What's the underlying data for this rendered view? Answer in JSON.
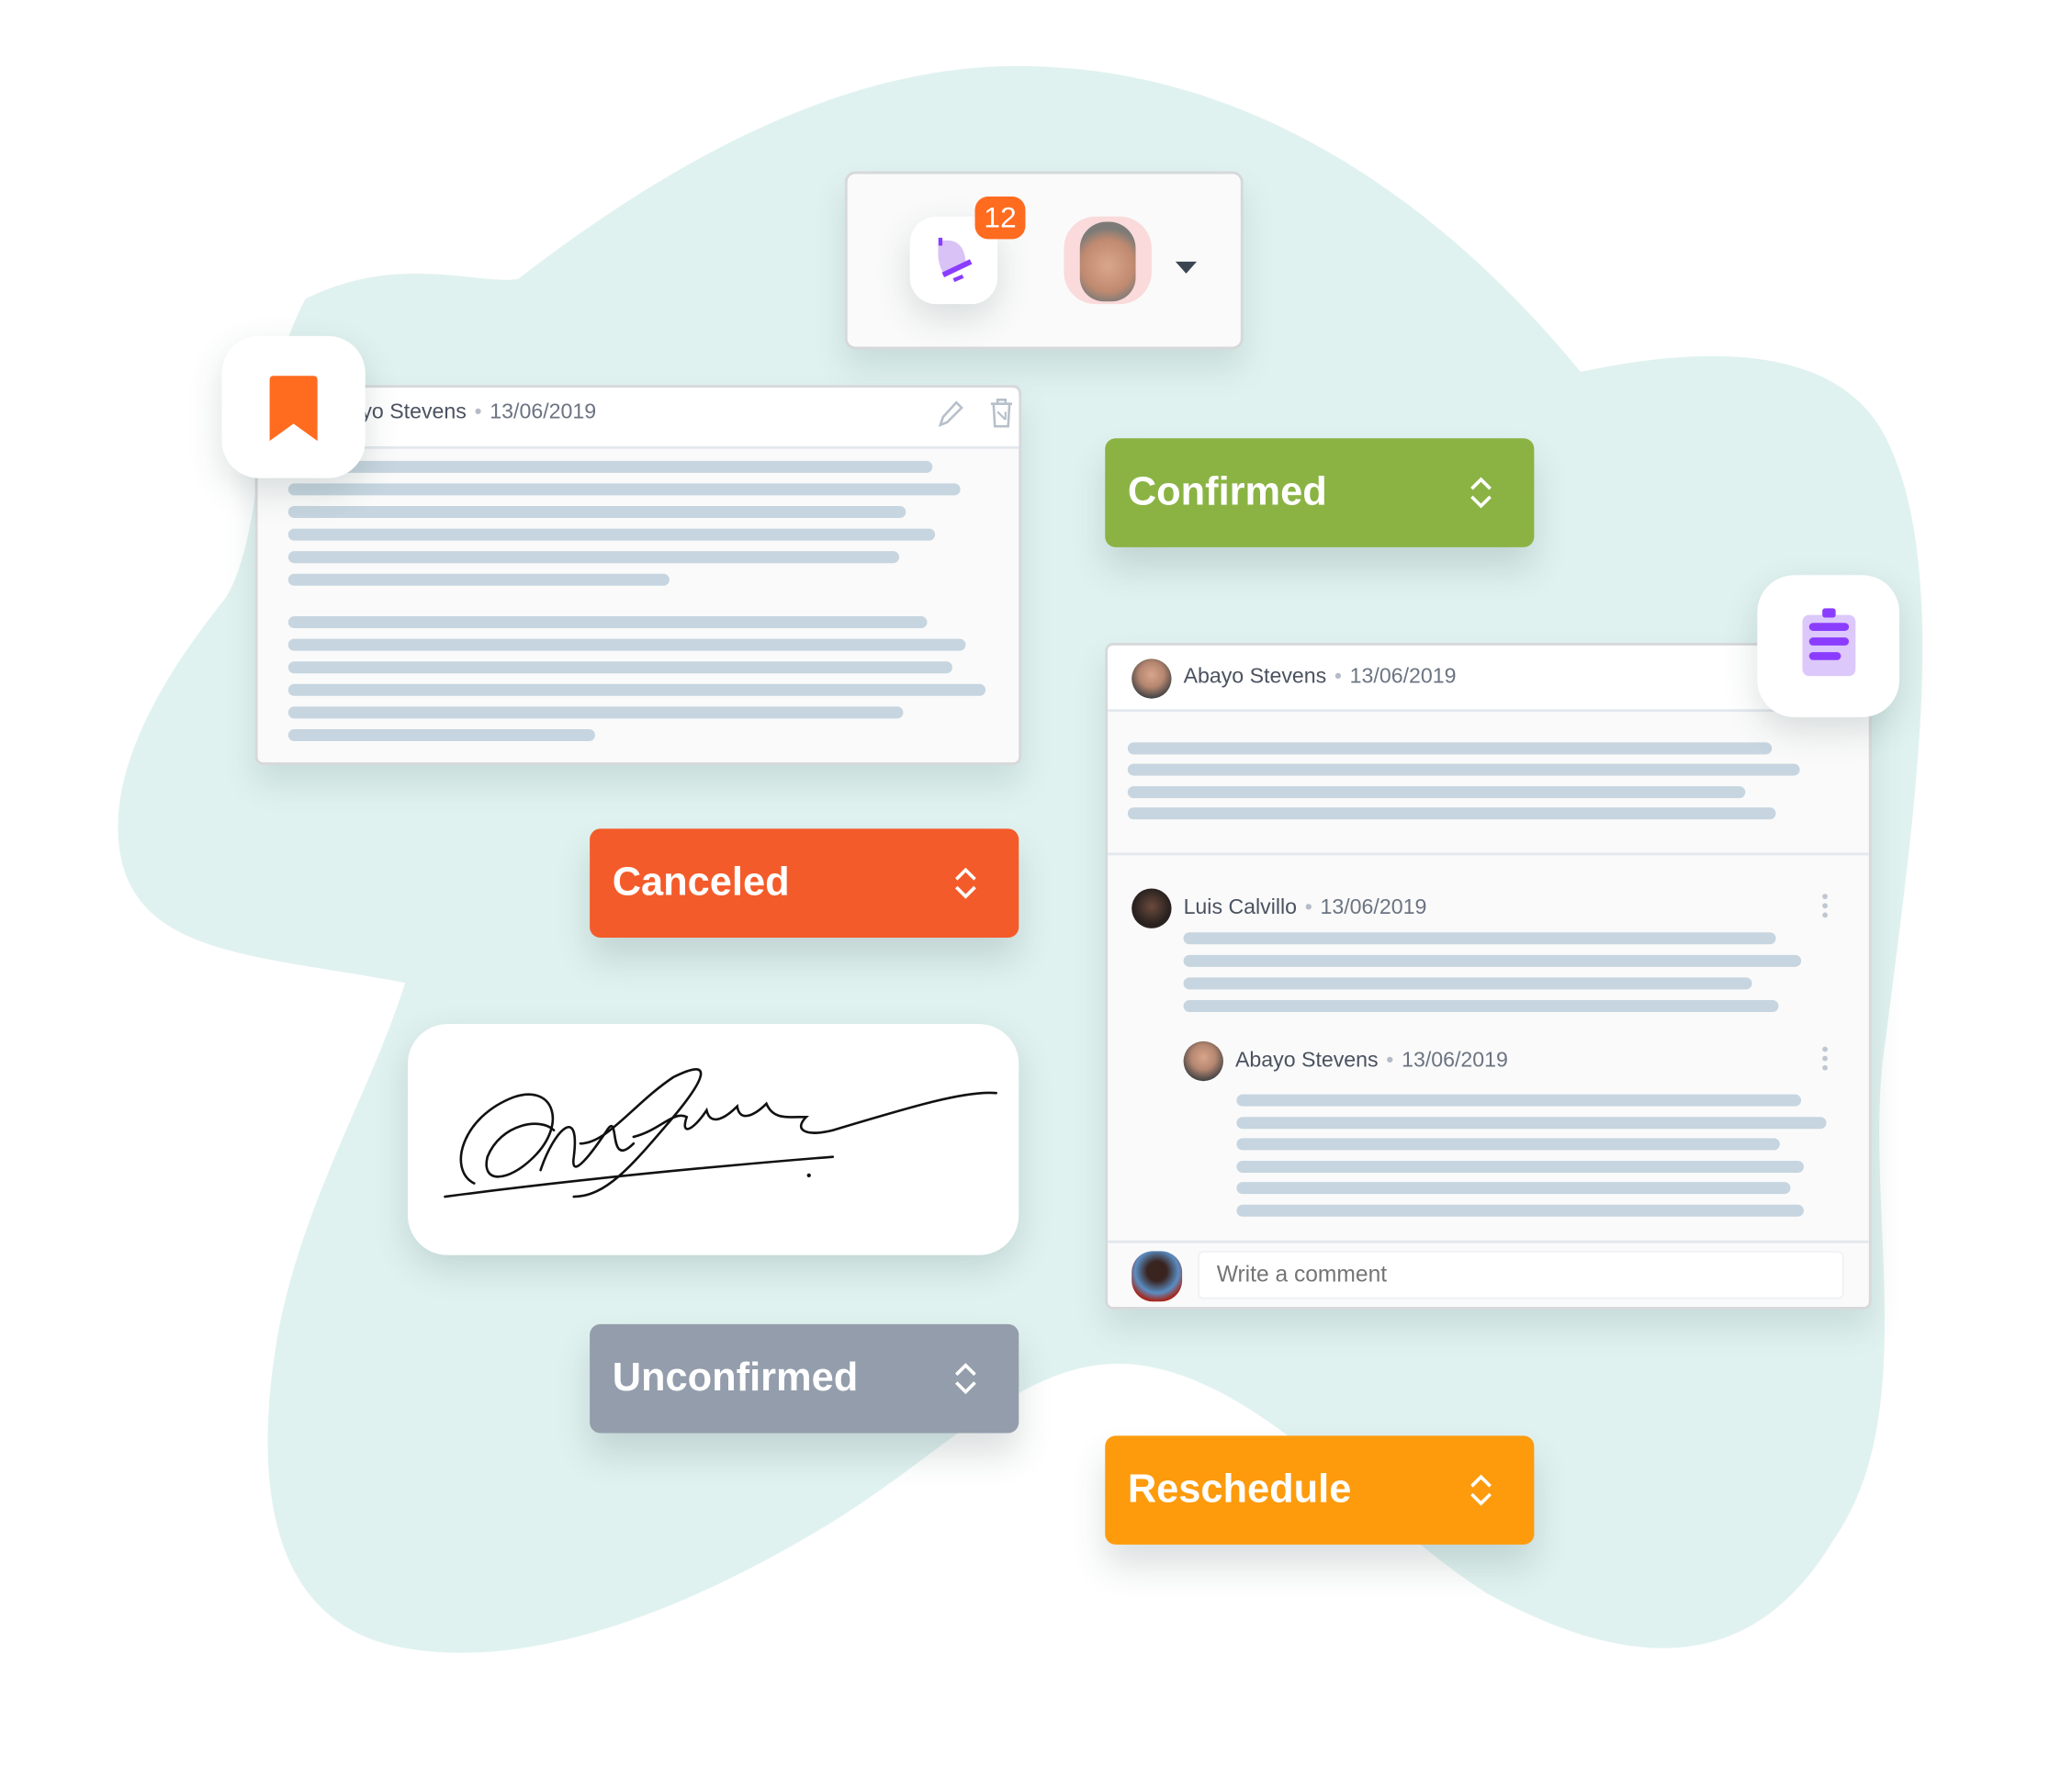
{
  "notifications": {
    "badge_count": "12",
    "icon": "bell-icon",
    "avatar": "user-avatar",
    "dropdown_icon": "caret-down-icon"
  },
  "document_card": {
    "author": "yo Stevens",
    "date": "13/06/2019",
    "edit_icon": "pencil-icon",
    "delete_icon": "trash-icon"
  },
  "bookmark": {
    "icon": "bookmark-icon",
    "color": "#ff6b1f"
  },
  "clipboard": {
    "icon": "clipboard-icon",
    "color": "#8b3dff"
  },
  "statuses": [
    {
      "label": "Confirmed",
      "color": "#8ab343"
    },
    {
      "label": "Canceled",
      "color": "#f45b2a"
    },
    {
      "label": "Unconfirmed",
      "color": "#939dab"
    },
    {
      "label": "Reschedule",
      "color": "#fd9b0d"
    }
  ],
  "comments": {
    "post": {
      "author": "Abayo Stevens",
      "date": "13/06/2019"
    },
    "items": [
      {
        "author": "Luis Calvillo",
        "date": "13/06/2019"
      },
      {
        "author": "Abayo Stevens",
        "date": "13/06/2019"
      }
    ],
    "input_placeholder": "Write a comment"
  },
  "colors": {
    "background_blob": "#e0f2f0",
    "skeleton": "#c6d5df"
  }
}
